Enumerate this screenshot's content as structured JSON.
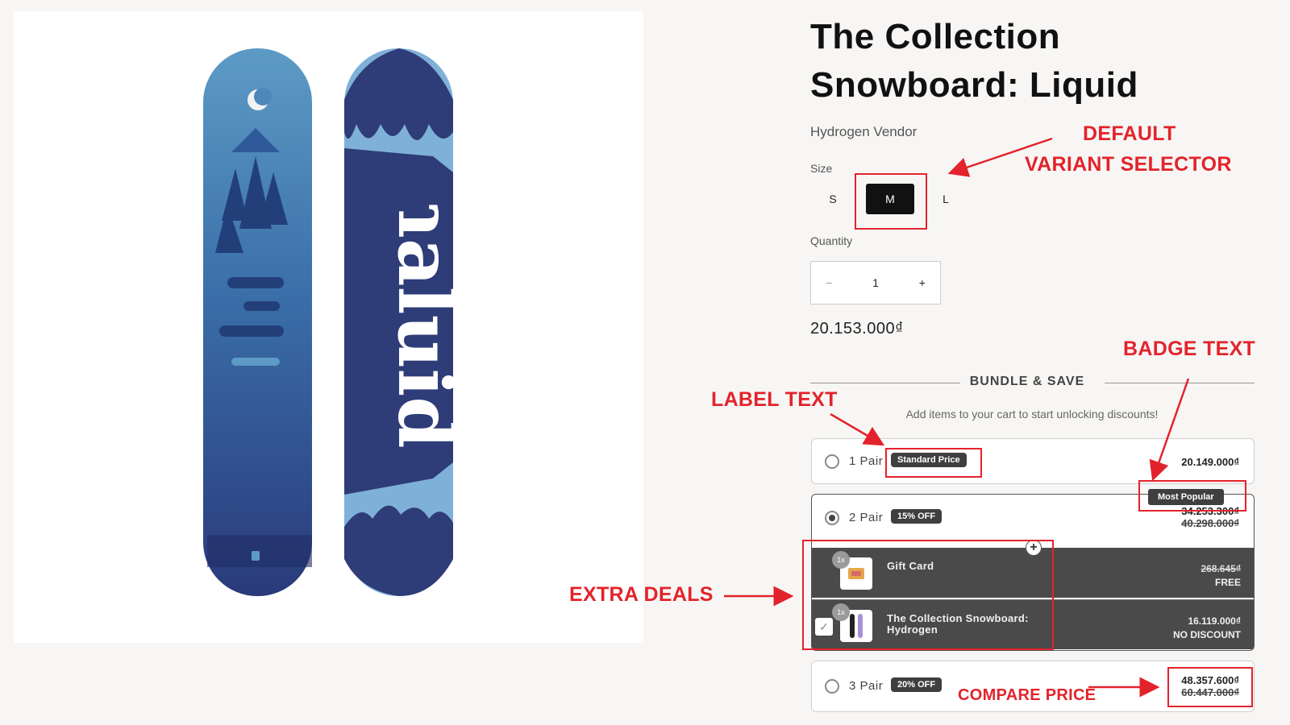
{
  "product": {
    "title_line1": "The Collection",
    "title_line2": "Snowboard: Liquid",
    "vendor": "Hydrogen Vendor",
    "size_label": "Size",
    "sizes": [
      "S",
      "M",
      "L"
    ],
    "selected_size": "M",
    "quantity_label": "Quantity",
    "quantity": "1",
    "qty_minus": "−",
    "qty_plus": "+",
    "price": "20.153.000₫"
  },
  "bundle": {
    "title": "BUNDLE & SAVE",
    "subtitle": "Add items to your cart to start unlocking discounts!",
    "offers": [
      {
        "label": "1 Pair",
        "pill": "Standard Price",
        "price": "20.149.000₫",
        "selected": false
      },
      {
        "label": "2 Pair",
        "pill": "15% OFF",
        "badge": "Most Popular",
        "price": "34.253.300₫",
        "compare_price": "40.298.000₫",
        "selected": true,
        "extras": [
          {
            "qty": "1x",
            "name": "Gift Card",
            "price": "268.645₫",
            "note": "FREE"
          },
          {
            "qty": "1x",
            "name_line1": "The Collection Snowboard:",
            "name_line2": "Hydrogen",
            "price": "16.119.000₫",
            "note": "NO DISCOUNT"
          }
        ]
      },
      {
        "label": "3 Pair",
        "pill": "20% OFF",
        "price": "48.357.600₫",
        "compare_price": "60.447.000₫",
        "selected": false
      }
    ]
  },
  "annotations": {
    "default_variant_1": "DEFAULT",
    "default_variant_2": "VARIANT SELECTOR",
    "badge_text": "BADGE TEXT",
    "label_text": "LABEL TEXT",
    "extra_deals": "EXTRA DEALS",
    "compare_price": "COMPARE PRICE",
    "color": "#e3232b"
  },
  "colors": {
    "dark_fill": "#4a4a4a",
    "pill_bg": "#3f3f3f",
    "accent_red": "#e3232b"
  }
}
